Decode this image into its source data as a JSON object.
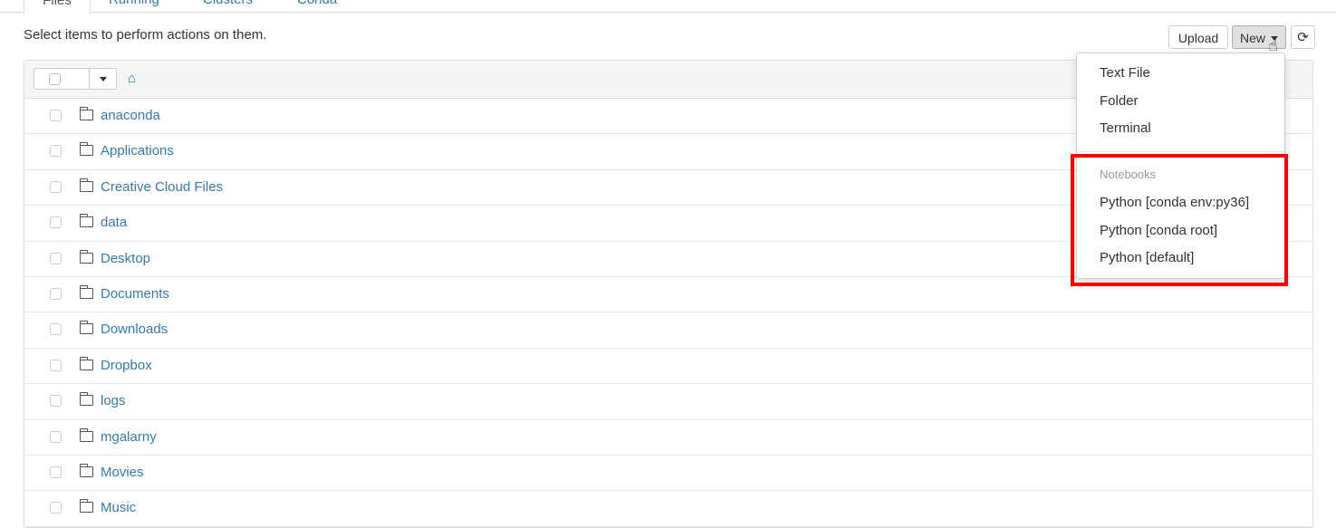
{
  "tabs": [
    {
      "label": "Files"
    },
    {
      "label": "Running"
    },
    {
      "label": "Clusters"
    },
    {
      "label": "Conda"
    }
  ],
  "toolbar": {
    "hint": "Select items to perform actions on them.",
    "upload_label": "Upload",
    "new_label": "New",
    "refresh_icon": "⟳"
  },
  "list": {
    "home_icon": "⌂",
    "items": [
      {
        "name": "anaconda"
      },
      {
        "name": "Applications"
      },
      {
        "name": "Creative Cloud Files"
      },
      {
        "name": "data"
      },
      {
        "name": "Desktop"
      },
      {
        "name": "Documents"
      },
      {
        "name": "Downloads"
      },
      {
        "name": "Dropbox"
      },
      {
        "name": "logs"
      },
      {
        "name": "mgalarny"
      },
      {
        "name": "Movies"
      },
      {
        "name": "Music"
      }
    ]
  },
  "new_menu": {
    "items": [
      {
        "label": "Text File"
      },
      {
        "label": "Folder"
      },
      {
        "label": "Terminal"
      }
    ],
    "section_header": "Notebooks",
    "notebooks": [
      {
        "label": "Python [conda env:py36]"
      },
      {
        "label": "Python [conda root]"
      },
      {
        "label": "Python [default]"
      }
    ]
  },
  "colors": {
    "link": "#337ab7",
    "highlight": "#ff0000"
  }
}
